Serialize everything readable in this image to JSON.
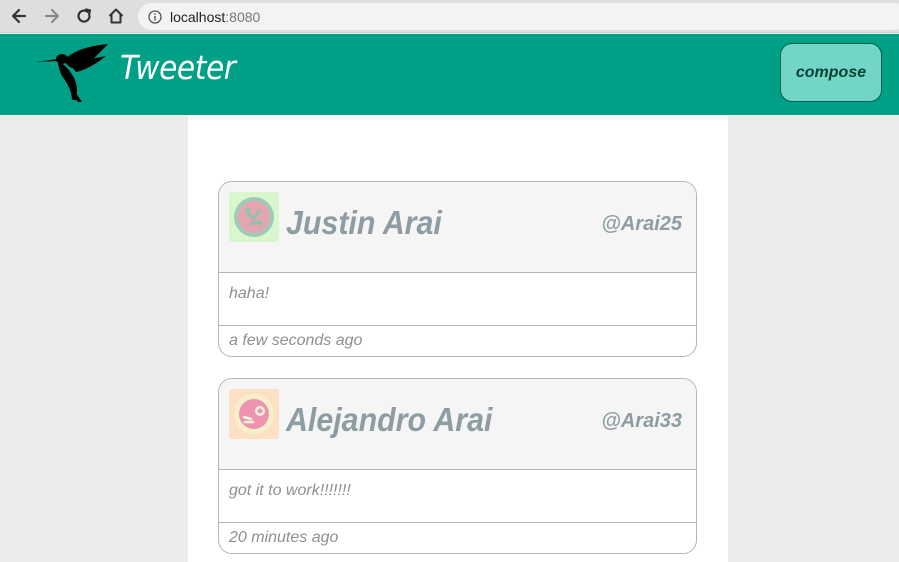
{
  "browser": {
    "url_host": "localhost",
    "url_port": ":8080"
  },
  "header": {
    "title": "Tweeter",
    "compose_label": "compose",
    "accent_color": "#00a087",
    "logo_icon": "hummingbird-icon"
  },
  "tweets": [
    {
      "name": "Justin Arai",
      "handle": "@Arai25",
      "content": "haha!",
      "timestamp": "a few seconds ago",
      "avatar_icon": "avatar-icon"
    },
    {
      "name": "Alejandro Arai",
      "handle": "@Arai33",
      "content": "got it to work!!!!!!!",
      "timestamp": "20 minutes ago",
      "avatar_icon": "avatar-icon"
    }
  ]
}
